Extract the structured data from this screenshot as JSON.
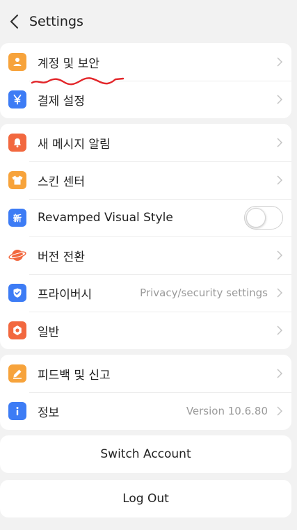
{
  "header": {
    "title": "Settings"
  },
  "groups": [
    {
      "items": [
        {
          "label": "계정 및 보안",
          "icon": "person-icon",
          "color": "#f7a33b"
        },
        {
          "label": "결제 설정",
          "icon": "yen-icon",
          "color": "#3d7cf5"
        }
      ]
    },
    {
      "items": [
        {
          "label": "새 메시지 알림",
          "icon": "bell-icon",
          "color": "#f2683f"
        },
        {
          "label": "스킨 센터",
          "icon": "shirt-icon",
          "color": "#f7a33b"
        },
        {
          "label": "Revamped Visual Style",
          "icon": "new-style-icon",
          "color": "#3d7cf5",
          "toggle": false
        },
        {
          "label": "버전 전환",
          "icon": "planet-icon",
          "color": "#f2683f"
        },
        {
          "label": "프라이버시",
          "sub": "Privacy/security settings",
          "icon": "shield-icon",
          "color": "#3d7cf5"
        },
        {
          "label": "일반",
          "icon": "gear-icon",
          "color": "#f2683f"
        }
      ]
    },
    {
      "items": [
        {
          "label": "피드백 및 신고",
          "icon": "pencil-icon",
          "color": "#f7a33b"
        },
        {
          "label": "정보",
          "sub": "Version 10.6.80",
          "icon": "info-icon",
          "color": "#3d7cf5"
        }
      ]
    }
  ],
  "buttons": {
    "switch_account": "Switch Account",
    "log_out": "Log Out"
  },
  "new_style_glyph": "新",
  "colors": {
    "annotation": "#e3262a",
    "chevron": "#c4c4c4"
  }
}
